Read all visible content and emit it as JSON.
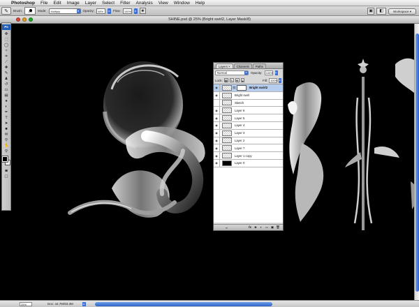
{
  "menubar": {
    "apple": "",
    "items": [
      "Photoshop",
      "File",
      "Edit",
      "Image",
      "Layer",
      "Select",
      "Filter",
      "Analysis",
      "View",
      "Window",
      "Help"
    ]
  },
  "options": {
    "brush_label": "Brush:",
    "brush_size": "100",
    "mode_label": "Mode:",
    "mode_value": "Multiply",
    "opacity_label": "Opacity:",
    "opacity_value": "48%",
    "flow_label": "Flow:",
    "flow_value": "100%",
    "workspace_label": "Workspace"
  },
  "document": {
    "title": "SHINE.psd @ 25% (Bright swirl2, Layer Mask/8)"
  },
  "status": {
    "zoom": "25%",
    "doc_info": "Doc: 44.7M/83.3M"
  },
  "layers_panel": {
    "tabs": [
      "Layers ×",
      "Channels",
      "Paths"
    ],
    "blend_mode": "Normal",
    "opacity_label": "Opacity:",
    "opacity_value": "100%",
    "lock_label": "Lock:",
    "fill_label": "Fill:",
    "fill_value": "100%",
    "layers": [
      {
        "name": "Bright swirl2",
        "selected": true,
        "mask": true
      },
      {
        "name": "Bright swirl"
      },
      {
        "name": "Sketch"
      },
      {
        "name": "Layer 6"
      },
      {
        "name": "Layer 5"
      },
      {
        "name": "Layer 4"
      },
      {
        "name": "Layer 3"
      },
      {
        "name": "Layer 2"
      },
      {
        "name": "Layer 7"
      },
      {
        "name": "Layer 1 copy"
      },
      {
        "name": "Layer 0",
        "black": true
      }
    ],
    "footer_link": "∞",
    "footer_fx": "fx"
  },
  "colors": {
    "accent": "#2d63c8",
    "selection": "#b6cdee",
    "canvas": "#000000"
  }
}
